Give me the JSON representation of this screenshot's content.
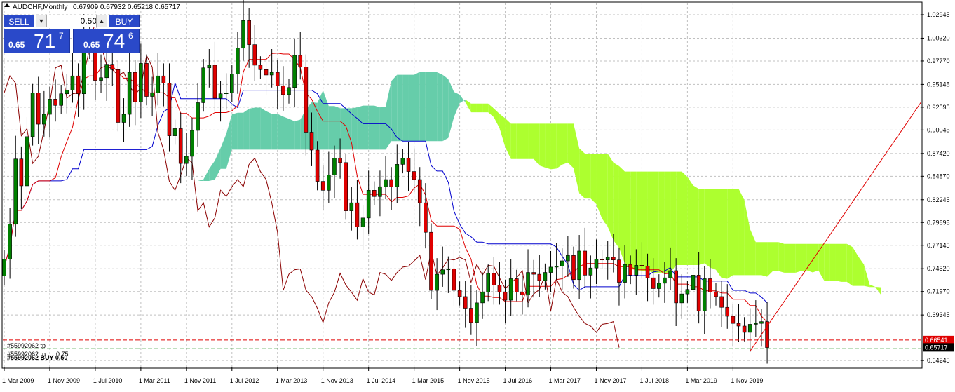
{
  "header": {
    "symbol_line": "AUDCHF,Monthly",
    "ohlc_line": "0.67909 0.67932 0.65218 0.65717"
  },
  "trade_panel": {
    "sell_label": "SELL",
    "buy_label": "BUY",
    "lot_value": "0.50",
    "sell_prefix": "0.65",
    "sell_big": "71",
    "sell_sup": "7",
    "buy_prefix": "0.65",
    "buy_big": "74",
    "buy_sup": "6"
  },
  "order_labels": {
    "tp_label": "#55992062 tp",
    "overlap_label": "#55992062 BUY 0.50",
    "overlap_extra": "0.75"
  },
  "colors": {
    "bull": "#008000",
    "bear": "#e00000",
    "kumo_bull": "#66cdaa",
    "kumo_bear": "#adff2f",
    "tenkan": "#e00000",
    "kijun": "#0000cd",
    "chikou": "#8b0000",
    "grid": "#c0c0c0",
    "tp_line": "#e00000",
    "entry_line": "#008000"
  },
  "chart_data": {
    "type": "candlestick",
    "instrument": "AUDCHF",
    "timeframe": "Monthly",
    "y_range": [
      0.6347,
      1.0428
    ],
    "y_ticks": [
      "1.02945",
      "1.00320",
      "0.97770",
      "0.95145",
      "0.92595",
      "0.90045",
      "0.87420",
      "0.84870",
      "0.82245",
      "0.79695",
      "0.77145",
      "0.74520",
      "0.71970",
      "0.69345",
      "0.64245"
    ],
    "x_ticks": [
      "1 Mar 2009",
      "1 Nov 2009",
      "1 Jul 2010",
      "1 Mar 2011",
      "1 Nov 2011",
      "1 Jul 2012",
      "1 Mar 2013",
      "1 Nov 2013",
      "1 Jul 2014",
      "1 Mar 2015",
      "1 Nov 2015",
      "1 Jul 2016",
      "1 Mar 2017",
      "1 Nov 2017",
      "1 Jul 2018",
      "1 Mar 2019",
      "1 Nov 2019"
    ],
    "price_tags": [
      {
        "label": "0.66541",
        "value": 0.66541,
        "color": "#e00000"
      },
      {
        "label": "0.65717",
        "value": 0.65717,
        "color": "#000000"
      }
    ],
    "closes": [
      0.756,
      0.795,
      0.868,
      0.838,
      0.893,
      0.942,
      0.907,
      0.918,
      0.935,
      0.928,
      0.941,
      0.945,
      0.961,
      0.941,
      1.008,
      0.99,
      0.956,
      0.959,
      0.974,
      0.968,
      0.909,
      0.918,
      0.965,
      0.932,
      0.975,
      0.938,
      0.942,
      0.961,
      0.953,
      0.894,
      0.902,
      0.863,
      0.871,
      0.9,
      0.931,
      0.97,
      0.973,
      0.936,
      0.941,
      0.942,
      0.963,
      0.992,
      1.023,
      0.996,
      0.973,
      0.968,
      0.962,
      0.965,
      0.95,
      0.94,
      0.948,
      0.984,
      0.971,
      0.898,
      0.878,
      0.843,
      0.833,
      0.85,
      0.869,
      0.864,
      0.81,
      0.819,
      0.792,
      0.802,
      0.833,
      0.826,
      0.837,
      0.845,
      0.837,
      0.862,
      0.869,
      0.854,
      0.845,
      0.819,
      0.786,
      0.721,
      0.739,
      0.744,
      0.745,
      0.721,
      0.714,
      0.701,
      0.685,
      0.707,
      0.719,
      0.74,
      0.727,
      0.719,
      0.71,
      0.734,
      0.719,
      0.716,
      0.741,
      0.739,
      0.732,
      0.741,
      0.747,
      0.748,
      0.754,
      0.76,
      0.733,
      0.765,
      0.738,
      0.746,
      0.756,
      0.755,
      0.758,
      0.755,
      0.73,
      0.75,
      0.738,
      0.749,
      0.748,
      0.735,
      0.723,
      0.729,
      0.735,
      0.743,
      0.707,
      0.717,
      0.722,
      0.738,
      0.698,
      0.734,
      0.719,
      0.714,
      0.702,
      0.692,
      0.684,
      0.681,
      0.674,
      0.683,
      0.684,
      0.686,
      0.657
    ],
    "series": [
      {
        "name": "Tenkan-sen"
      },
      {
        "name": "Kijun-sen"
      },
      {
        "name": "Chikou Span"
      },
      {
        "name": "Senkou Span A"
      },
      {
        "name": "Senkou Span B"
      }
    ],
    "objects": [
      {
        "type": "trend_line",
        "from_date": "Nov 2019",
        "from_price": 0.653,
        "to_date": "right edge",
        "to_price": 0.932
      },
      {
        "type": "take_profit",
        "price": 0.66541
      },
      {
        "type": "entry",
        "price": 0.6557
      }
    ]
  }
}
